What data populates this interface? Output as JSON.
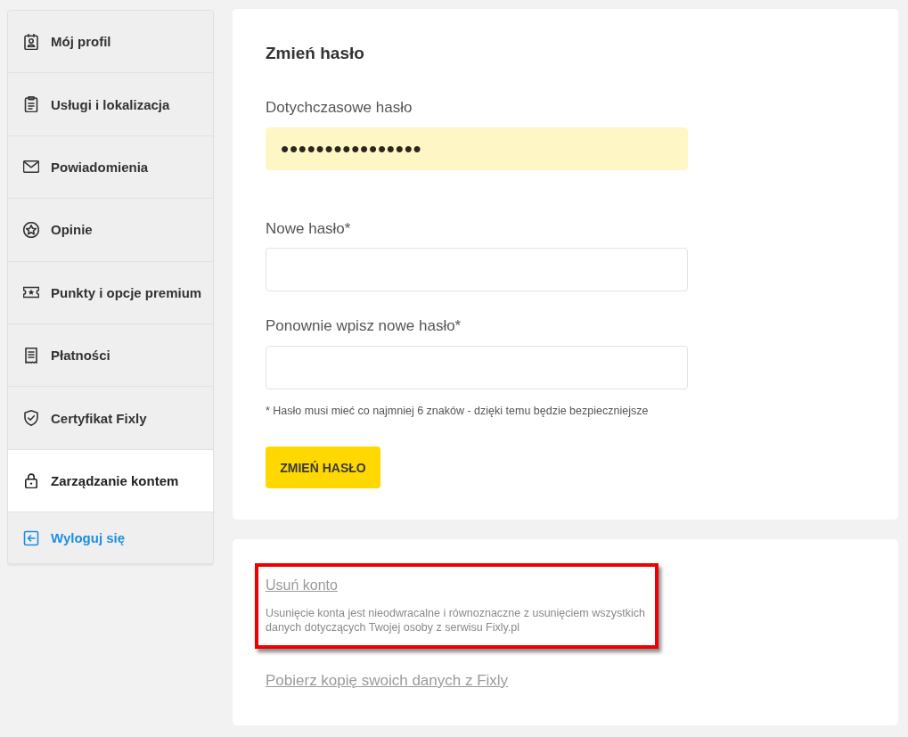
{
  "sidebar": {
    "items": [
      {
        "label": "Mój profil",
        "kind": "nav",
        "selected": false
      },
      {
        "label": "Usługi i lokalizacja",
        "kind": "nav",
        "selected": false
      },
      {
        "label": "Powiadomienia",
        "kind": "nav",
        "selected": false
      },
      {
        "label": "Opinie",
        "kind": "nav",
        "selected": false
      },
      {
        "label": "Punkty i opcje premium",
        "kind": "nav",
        "selected": false
      },
      {
        "label": "Płatności",
        "kind": "nav",
        "selected": false
      },
      {
        "label": "Certyfikat Fixly",
        "kind": "nav",
        "selected": false
      },
      {
        "label": "Zarządzanie kontem",
        "kind": "nav",
        "selected": true
      },
      {
        "label": "Wyloguj się",
        "kind": "logout",
        "selected": false
      }
    ]
  },
  "change_password": {
    "title": "Zmień hasło",
    "fields": [
      {
        "label": "Dotychczasowe hasło",
        "value": "••••••••••••••••",
        "autofilled": true
      },
      {
        "label": "Nowe hasło*",
        "autofilled": false
      },
      {
        "label": "Ponownie wpisz nowe hasło*",
        "autofilled": false
      }
    ],
    "hint": "* Hasło musi mieć co najmniej 6 znaków - dzięki temu będzie bezpieczniejsze",
    "button": "ZMIEŃ HASŁO"
  },
  "account_actions": {
    "delete_account": {
      "link": "Usuń konto",
      "description": "Usunięcie konta jest nieodwracalne i równoznaczne z usunięciem wszystkich danych dotyczących Twojej osoby z serwisu Fixly.pl",
      "highlighted": true
    },
    "download_link": "Pobierz kopię swoich danych z Fixly"
  }
}
